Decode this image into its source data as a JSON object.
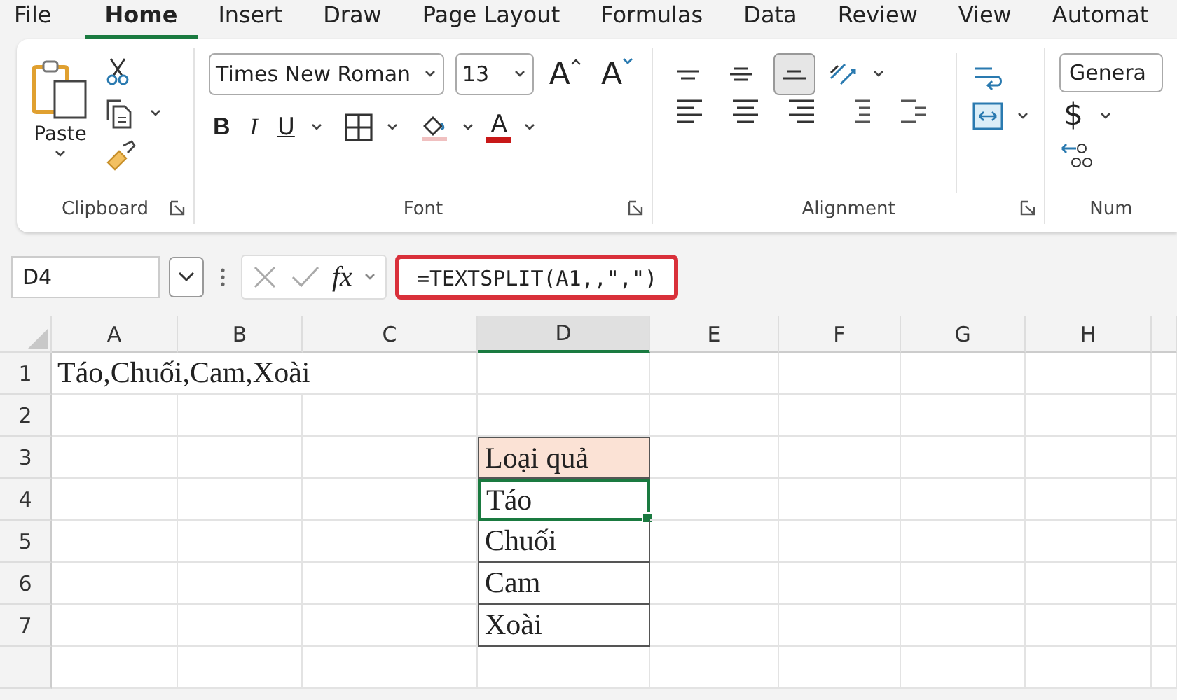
{
  "tabs": [
    {
      "label": "File",
      "selected": false
    },
    {
      "label": "Home",
      "selected": true
    },
    {
      "label": "Insert",
      "selected": false
    },
    {
      "label": "Draw",
      "selected": false
    },
    {
      "label": "Page Layout",
      "selected": false
    },
    {
      "label": "Formulas",
      "selected": false
    },
    {
      "label": "Data",
      "selected": false
    },
    {
      "label": "Review",
      "selected": false
    },
    {
      "label": "View",
      "selected": false
    },
    {
      "label": "Automat",
      "selected": false
    }
  ],
  "clipboard": {
    "paste_label": "Paste",
    "group_label": "Clipboard"
  },
  "font": {
    "font_name": "Times New Roman",
    "font_size": "13",
    "grow_glyph": "A",
    "shrink_glyph": "A",
    "bold_glyph": "B",
    "italic_glyph": "I",
    "underline_glyph": "U",
    "color_glyph": "A",
    "group_label": "Font"
  },
  "alignment": {
    "vertical": [
      {
        "kind": "top",
        "selected": false
      },
      {
        "kind": "middle",
        "selected": false
      },
      {
        "kind": "bottom",
        "selected": true
      }
    ],
    "horizontal": [
      {
        "kind": "left"
      },
      {
        "kind": "center"
      },
      {
        "kind": "right"
      },
      {
        "kind": "outdent"
      },
      {
        "kind": "indent"
      }
    ],
    "group_label": "Alignment"
  },
  "number": {
    "format": "Genera",
    "currency_glyph": "$",
    "group_label": "Num"
  },
  "formula_bar": {
    "name_box": "D4",
    "fx": "fx",
    "formula": "=TEXTSPLIT(A1,,\",\")"
  },
  "sheet": {
    "columns": [
      {
        "label": "A",
        "selected": false
      },
      {
        "label": "B",
        "selected": false
      },
      {
        "label": "C",
        "selected": false
      },
      {
        "label": "D",
        "selected": true
      },
      {
        "label": "E",
        "selected": false
      },
      {
        "label": "F",
        "selected": false
      },
      {
        "label": "G",
        "selected": false
      },
      {
        "label": "H",
        "selected": false
      }
    ],
    "rows": [
      {
        "label": "1"
      },
      {
        "label": "2"
      },
      {
        "label": "3"
      },
      {
        "label": "4"
      },
      {
        "label": "5"
      },
      {
        "label": "6"
      },
      {
        "label": "7"
      }
    ],
    "source_cell": {
      "text": "Táo,Chuối,Cam,Xoài"
    },
    "table": {
      "header": "Loại quả",
      "items": [
        {
          "text": "Táo",
          "selected": true
        },
        {
          "text": "Chuối",
          "selected": false
        },
        {
          "text": "Cam",
          "selected": false
        },
        {
          "text": "Xoài",
          "selected": false
        }
      ]
    }
  }
}
